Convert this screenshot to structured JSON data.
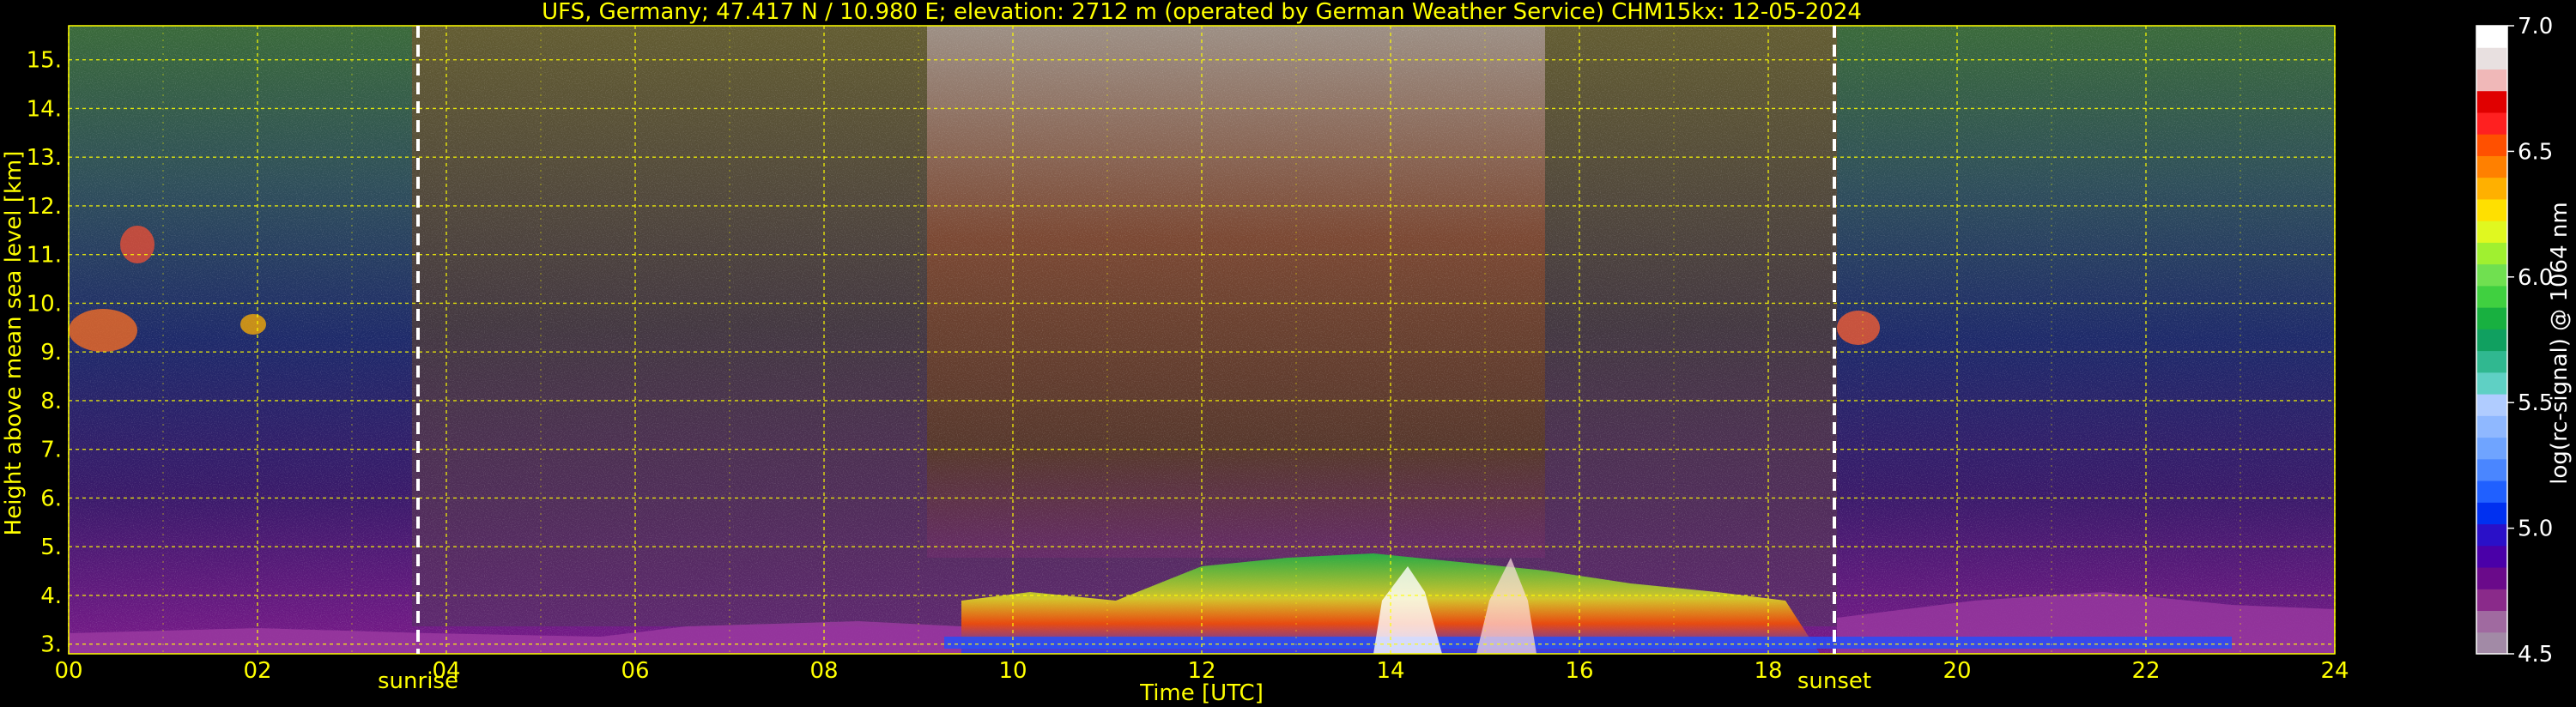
{
  "chart_data": {
    "type": "heatmap",
    "title": "UFS, Germany; 47.417 N / 10.980 E; elevation: 2712 m  (operated by German Weather Service)    CHM15kx: 12-05-2024",
    "xlabel": "Time [UTC]",
    "ylabel": "Height above mean sea level [km]",
    "xlim": [
      0,
      24
    ],
    "ylim": [
      2.8,
      15.7
    ],
    "x_ticks": [
      "00",
      "02",
      "04",
      "06",
      "08",
      "10",
      "12",
      "14",
      "16",
      "18",
      "20",
      "22",
      "24"
    ],
    "y_ticks": [
      "3.",
      "4.",
      "5.",
      "6.",
      "7.",
      "8.",
      "9.",
      "10.",
      "11.",
      "12.",
      "13.",
      "14.",
      "15."
    ],
    "grid": true,
    "annotations": [
      {
        "label": "sunrise",
        "x": 3.7
      },
      {
        "label": "sunset",
        "x": 18.7
      }
    ],
    "colorbar": {
      "label": "log(rc-signal) @ 1064 nm",
      "range": [
        4.5,
        7.0
      ],
      "ticks": [
        "4.5",
        "5.0",
        "5.5",
        "6.0",
        "6.5",
        "7.0"
      ],
      "colors": [
        "#a28aa6",
        "#a06aa0",
        "#8a2a8a",
        "#6a0a8a",
        "#4a00a8",
        "#2a10c8",
        "#0030f0",
        "#2060ff",
        "#4a86ff",
        "#6fa4ff",
        "#8fb8ff",
        "#b0ccff",
        "#5fd0c4",
        "#30b890",
        "#10a060",
        "#18b040",
        "#40d040",
        "#70e050",
        "#a0f030",
        "#e0f820",
        "#ffe000",
        "#ffb000",
        "#ff8000",
        "#ff5000",
        "#ff2020",
        "#e00000",
        "#f0b8b8",
        "#e8e0e0",
        "#ffffff"
      ]
    }
  }
}
